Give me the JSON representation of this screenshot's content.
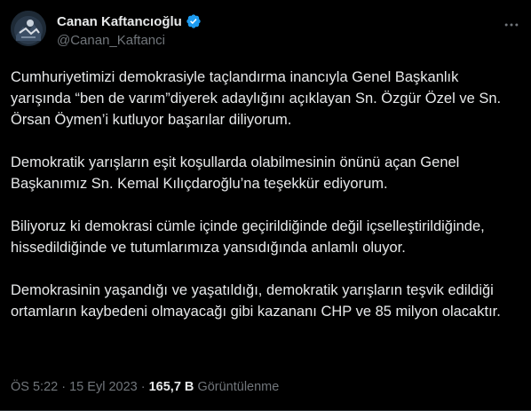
{
  "author": {
    "display_name": "Canan Kaftancıoğlu",
    "handle": "@Canan_Kaftanci",
    "verified_color": "#1d9bf0"
  },
  "tweet": {
    "paragraphs": [
      "Cumhuriyetimizi demokrasiyle taçlandırma inancıyla Genel Başkanlık yarışında “ben de varım”diyerek adaylığını açıklayan Sn. Özgür Özel ve Sn. Örsan Öymen’i kutluyor başarılar diliyorum.",
      "Demokratik yarışların eşit koşullarda olabilmesinin önünü açan Genel Başkanımız Sn. Kemal Kılıçdaroğlu’na teşekkür ediyorum.",
      "Biliyoruz ki demokrasi cümle içinde geçirildiğinde değil içselleştirildiğinde, hissedildiğinde ve tutumlarımıza yansıdığında anlamlı oluyor.",
      "Demokrasinin yaşandığı ve yaşatıldığı, demokratik yarışların teşvik edildiği ortamların kaybedeni olmayacağı gibi kazananı CHP ve 85 milyon olacaktır."
    ]
  },
  "meta": {
    "time": "ÖS 5:22",
    "separator": "·",
    "date": "15 Eyl 2023",
    "views_count": "165,7 B",
    "views_label": "Görüntülenme"
  },
  "icons": {
    "verified": "verified-badge-icon",
    "more": "more-options-icon"
  }
}
